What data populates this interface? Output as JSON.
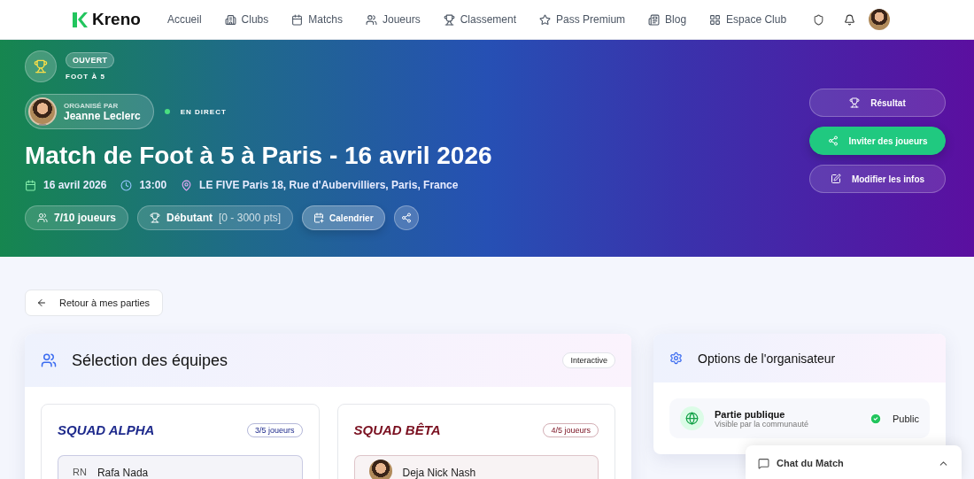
{
  "nav": {
    "logo": "Kreno",
    "items": [
      {
        "label": "Accueil"
      },
      {
        "label": "Clubs"
      },
      {
        "label": "Matchs"
      },
      {
        "label": "Joueurs"
      },
      {
        "label": "Classement"
      },
      {
        "label": "Pass Premium"
      },
      {
        "label": "Blog"
      },
      {
        "label": "Espace Club"
      }
    ]
  },
  "hero": {
    "status": "OUVERT",
    "format": "FOOT À 5",
    "organizer_label": "ORGANISÉ PAR",
    "organizer": "Jeanne Leclerc",
    "live": "EN DIRECT",
    "title": "Match de Foot à 5 à Paris - 16 avril 2026",
    "date": "16 avril 2026",
    "time": "13:00",
    "location": "LE FIVE Paris 18, Rue d'Aubervilliers, Paris, France",
    "players": "7/10 joueurs",
    "level": "Débutant",
    "level_range": "[0 - 3000 pts]",
    "calendar": "Calendrier",
    "actions": [
      {
        "label": "Résultat",
        "kind": "ghost"
      },
      {
        "label": "Inviter des joueurs",
        "kind": "primary"
      },
      {
        "label": "Modifier les infos",
        "kind": "ghost"
      }
    ]
  },
  "back": "Retour à mes parties",
  "teams_panel": {
    "title": "Sélection des équipes",
    "badge": "Interactive",
    "teams": [
      {
        "name": "SQUAD ALPHA",
        "count": "3/5 joueurs",
        "color": "#1e2a8c",
        "players": [
          {
            "initials": "RN",
            "name": "Rafa Nada"
          }
        ]
      },
      {
        "name": "SQUAD BÊTA",
        "count": "4/5 joueurs",
        "color": "#7a1020",
        "players": [
          {
            "name": "Deja Nick Nash"
          }
        ]
      }
    ]
  },
  "options_panel": {
    "title": "Options de l'organisateur",
    "option": {
      "title": "Partie publique",
      "subtitle": "Visible par la communauté",
      "value": "Public",
      "on": true
    }
  },
  "chat": {
    "title": "Chat du Match",
    "expanded": false
  }
}
